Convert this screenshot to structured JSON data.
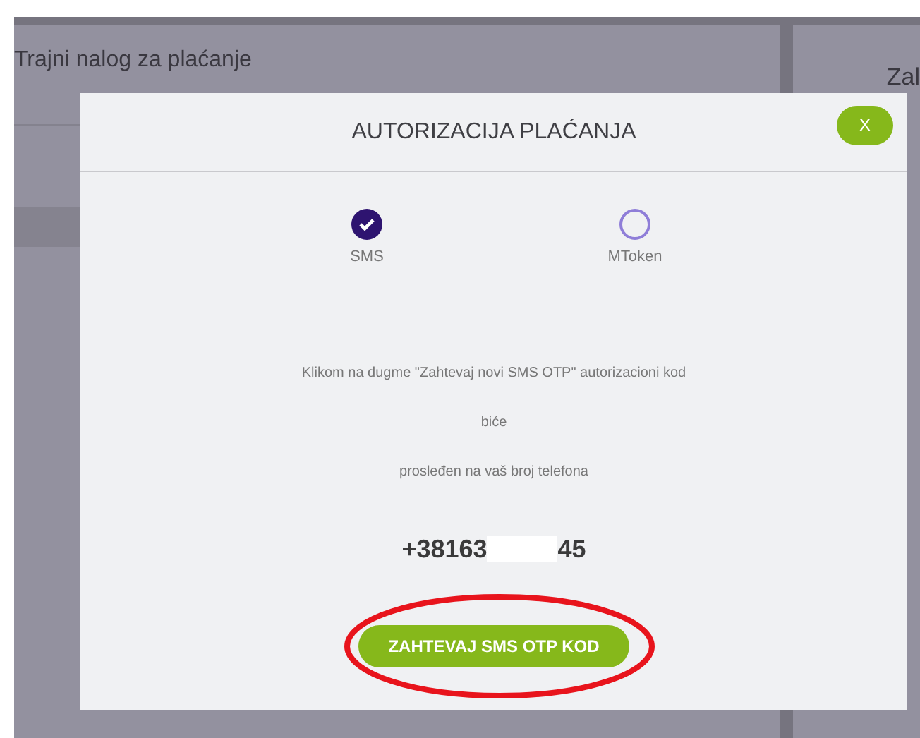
{
  "background": {
    "cards": [
      {
        "title_lines": [
          "Trajni nalog za plaćanje"
        ]
      },
      {
        "title_lines": [
          "Zal"
        ]
      }
    ]
  },
  "modal": {
    "title": "AUTORIZACIJA PLAĆANJA",
    "close_label": "X",
    "methods": [
      {
        "label": "SMS",
        "selected": true
      },
      {
        "label": "MToken",
        "selected": false
      }
    ],
    "message_lines": [
      "Klikom na dugme \"Zahtevaj novi SMS OTP\" autorizacioni kod",
      "biće",
      "prosleđen na vaš broj telefona"
    ],
    "phone": {
      "prefix": "+38163",
      "suffix": "45",
      "redacted": true
    },
    "button": {
      "label": "ZAHTEVAJ SMS OTP KOD",
      "circled": true
    }
  }
}
